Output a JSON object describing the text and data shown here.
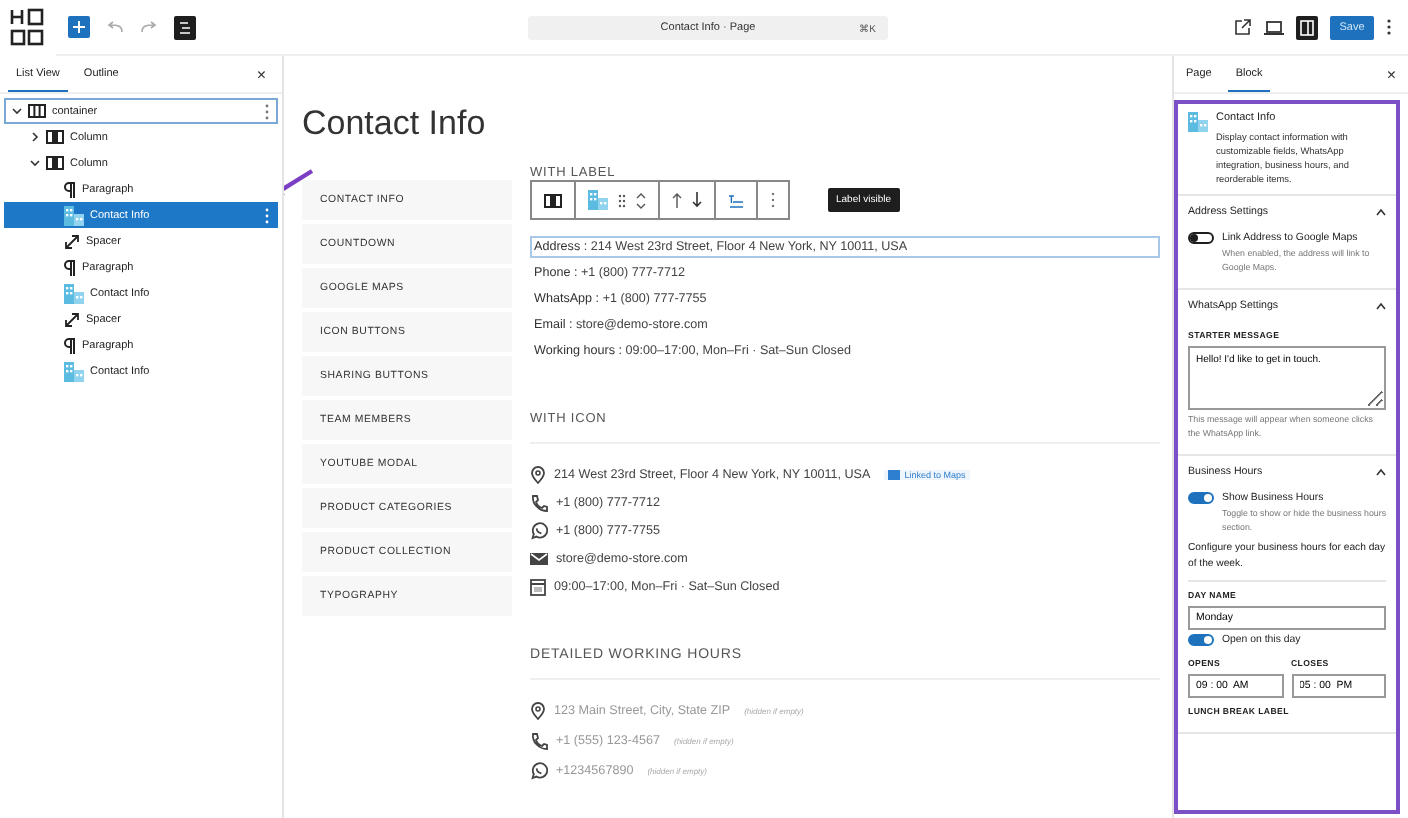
{
  "top_bar": {
    "document_title": "Contact Info · Page",
    "shortcut": "⌘K",
    "save": "Save"
  },
  "list_panel": {
    "tabs": [
      {
        "label": "List View",
        "selected": true
      },
      {
        "label": "Outline",
        "selected": false
      }
    ],
    "close": "×",
    "tree": [
      {
        "label": "container",
        "kind": "columns",
        "expanded": true,
        "selected": false,
        "focused": true,
        "children": [
          {
            "label": "Column",
            "kind": "column",
            "expanded": false,
            "selected": false,
            "focused": false
          },
          {
            "label": "Column",
            "kind": "column",
            "expanded": true,
            "selected": false,
            "focused": false,
            "children": [
              {
                "label": "Paragraph",
                "kind": "paragraph",
                "selected": false,
                "focused": false
              },
              {
                "label": "Contact Info",
                "kind": "contact",
                "selected": true,
                "focused": false
              },
              {
                "label": "Spacer",
                "kind": "spacer",
                "selected": false,
                "focused": false
              },
              {
                "label": "Paragraph",
                "kind": "paragraph",
                "selected": false,
                "focused": false
              },
              {
                "label": "Contact Info",
                "kind": "contact",
                "selected": false,
                "focused": false
              },
              {
                "label": "Spacer",
                "kind": "spacer",
                "selected": false,
                "focused": false
              },
              {
                "label": "Paragraph",
                "kind": "paragraph",
                "selected": false,
                "focused": false
              },
              {
                "label": "Contact Info",
                "kind": "contact",
                "selected": false,
                "focused": false
              }
            ]
          }
        ]
      }
    ]
  },
  "canvas": {
    "title": "Contact Info",
    "nav": [
      "CONTACT INFO",
      "COUNTDOWN",
      "GOOGLE MAPS",
      "ICON BUTTONS",
      "SHARING BUTTONS",
      "TEAM MEMBERS",
      "YOUTUBE MODAL",
      "PRODUCT CATEGORIES",
      "PRODUCT COLLECTION",
      "TYPOGRAPHY"
    ],
    "tooltip": "Label visible",
    "sections": [
      {
        "heading": "WITH LABEL",
        "kind": "label",
        "items": [
          {
            "label": "Address :",
            "value": "214 West 23rd Street, Floor 4 New York, NY 10011, USA",
            "selected": true
          },
          {
            "label": "Phone :",
            "value": "+1 (800) 777-7712",
            "selected": false
          },
          {
            "label": "WhatsApp :",
            "value": "+1 (800) 777-7755",
            "selected": false
          },
          {
            "label": "Email :",
            "value": "store@demo-store.com",
            "selected": false
          },
          {
            "label": "Working hours :",
            "value": "09:00–17:00, Mon–Fri · Sat–Sun Closed",
            "selected": false
          }
        ]
      },
      {
        "heading": "WITH ICON",
        "kind": "icon",
        "items": [
          {
            "kind": "pin",
            "value": "214 West 23rd Street, Floor 4 New York, NY 10011, USA",
            "badge": "Linked to Maps"
          },
          {
            "kind": "phone",
            "value": "+1 (800) 777-7712"
          },
          {
            "kind": "whatsapp",
            "value": "+1 (800) 777-7755"
          },
          {
            "kind": "mail",
            "value": "store@demo-store.com"
          },
          {
            "kind": "calendar",
            "value": "09:00–17:00, Mon–Fri · Sat–Sun Closed"
          }
        ]
      },
      {
        "heading": "DETAILED WORKING HOURS",
        "kind": "muted",
        "items": [
          {
            "kind": "pin",
            "value": "123 Main Street, City, State ZIP",
            "note": "(hidden if empty)"
          },
          {
            "kind": "phone",
            "value": "+1 (555) 123-4567",
            "note": "(hidden if empty)"
          },
          {
            "kind": "whatsapp",
            "value": "+1234567890",
            "note": "(hidden if empty)"
          }
        ]
      }
    ]
  },
  "settings": {
    "tabs": [
      {
        "label": "Page",
        "selected": false
      },
      {
        "label": "Block",
        "selected": true
      }
    ],
    "close": "×",
    "block": {
      "title": "Contact Info",
      "description": "Display contact information with customizable fields, WhatsApp integration, business hours, and reorderable items."
    },
    "panels": [
      {
        "title": "Address Settings",
        "expanded": true,
        "controls": [
          {
            "kind": "toggle",
            "label": "Link Address to Google Maps",
            "on": false,
            "help": "When enabled, the address will link to Google Maps."
          }
        ]
      },
      {
        "title": "WhatsApp Settings",
        "expanded": true,
        "controls": [
          {
            "kind": "textarea",
            "label": "STARTER MESSAGE",
            "value": "Hello! I'd like to get in touch.",
            "help": "This message will appear when someone clicks the WhatsApp link."
          }
        ]
      },
      {
        "title": "Business Hours",
        "expanded": true,
        "controls": [
          {
            "kind": "toggle",
            "label": "Show Business Hours",
            "on": true,
            "help": "Toggle to show or hide the business hours section."
          },
          {
            "kind": "text",
            "text": "Configure your business hours for each day of the week."
          },
          {
            "kind": "field",
            "label": "DAY NAME",
            "value": "Monday"
          },
          {
            "kind": "toggle",
            "label": "Open on this day",
            "on": true
          },
          {
            "kind": "pair",
            "fields": [
              {
                "label": "OPENS",
                "value": "09 : 00  AM"
              },
              {
                "label": "CLOSES",
                "value": "05 : 00  PM"
              }
            ]
          },
          {
            "kind": "label",
            "label": "LUNCH BREAK LABEL"
          }
        ]
      }
    ]
  }
}
